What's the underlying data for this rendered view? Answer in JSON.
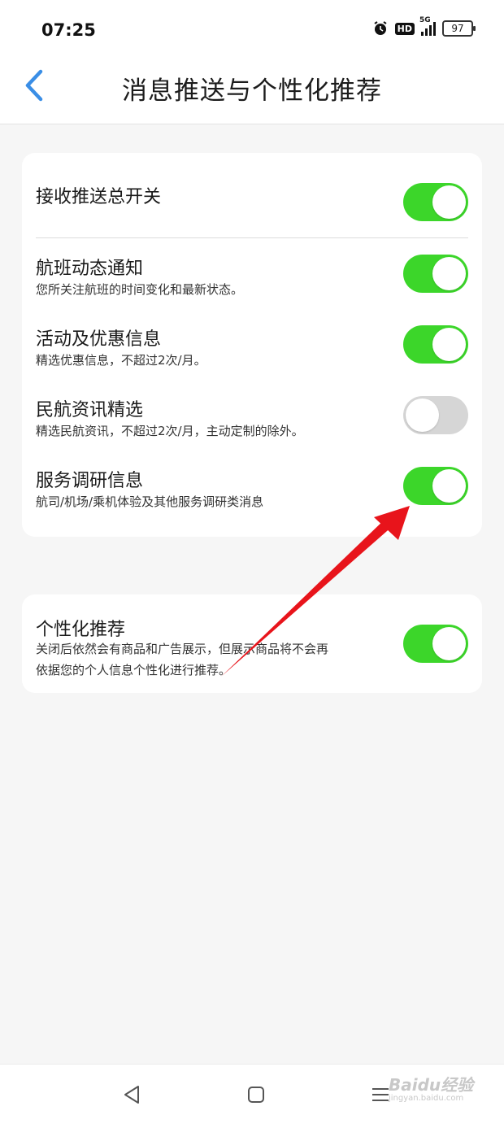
{
  "status_bar": {
    "time": "07:25",
    "icons": [
      "alarm-icon",
      "hd-icon",
      "signal-icon",
      "battery-icon"
    ],
    "hd_label": "HD",
    "network": "5G",
    "battery": "97"
  },
  "header": {
    "back_icon": "chevron-left-icon",
    "title": "消息推送与个性化推荐"
  },
  "push_settings": {
    "master": {
      "title": "接收推送总开关",
      "enabled": true
    },
    "items": [
      {
        "title": "航班动态通知",
        "desc": "您所关注航班的时间变化和最新状态。",
        "enabled": true
      },
      {
        "title": "活动及优惠信息",
        "desc": "精选优惠信息，不超过2次/月。",
        "enabled": true
      },
      {
        "title": "民航资讯精选",
        "desc": "精选民航资讯，不超过2次/月，主动定制的除外。",
        "enabled": false
      },
      {
        "title": "服务调研信息",
        "desc": "航司/机场/乘机体验及其他服务调研类消息",
        "enabled": true
      }
    ]
  },
  "personalization": {
    "title": "个性化推荐",
    "desc_line1": "关闭后依然会有商品和广告展示，但展示商品将不会再",
    "desc_line2": "依据您的个人信息个性化进行推荐。",
    "enabled": true
  },
  "annotation": {
    "arrow_color": "#e8141b"
  },
  "nav_bar": {
    "icons": [
      "back-triangle-icon",
      "home-square-icon",
      "menu-icon"
    ]
  },
  "watermark": {
    "text": "Baidu经验",
    "url_text": "jingyan.baidu.com"
  },
  "colors": {
    "toggle_on": "#3cd62a",
    "toggle_off": "#d6d6d6",
    "accent": "#3a8ee6"
  }
}
